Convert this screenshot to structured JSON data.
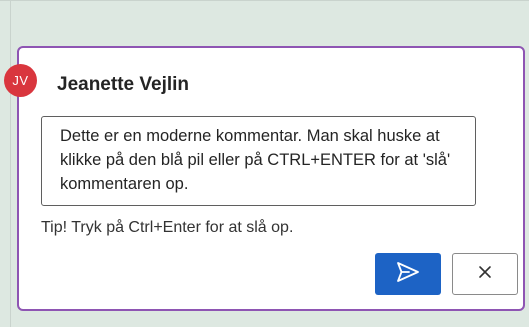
{
  "comment": {
    "avatar_initials": "JV",
    "author": "Jeanette Vejlin",
    "text": "Dette er en moderne kommentar. Man skal huske at klikke på den blå pil eller på CTRL+ENTER for at 'slå' kommentaren op.",
    "tip": "Tip! Tryk på Ctrl+Enter for at slå op."
  },
  "icons": {
    "send": "send-arrow-icon",
    "cancel": "close-x-icon"
  },
  "colors": {
    "card_border": "#8e55b3",
    "avatar_bg": "#d9363e",
    "send_button": "#1d63c5"
  }
}
